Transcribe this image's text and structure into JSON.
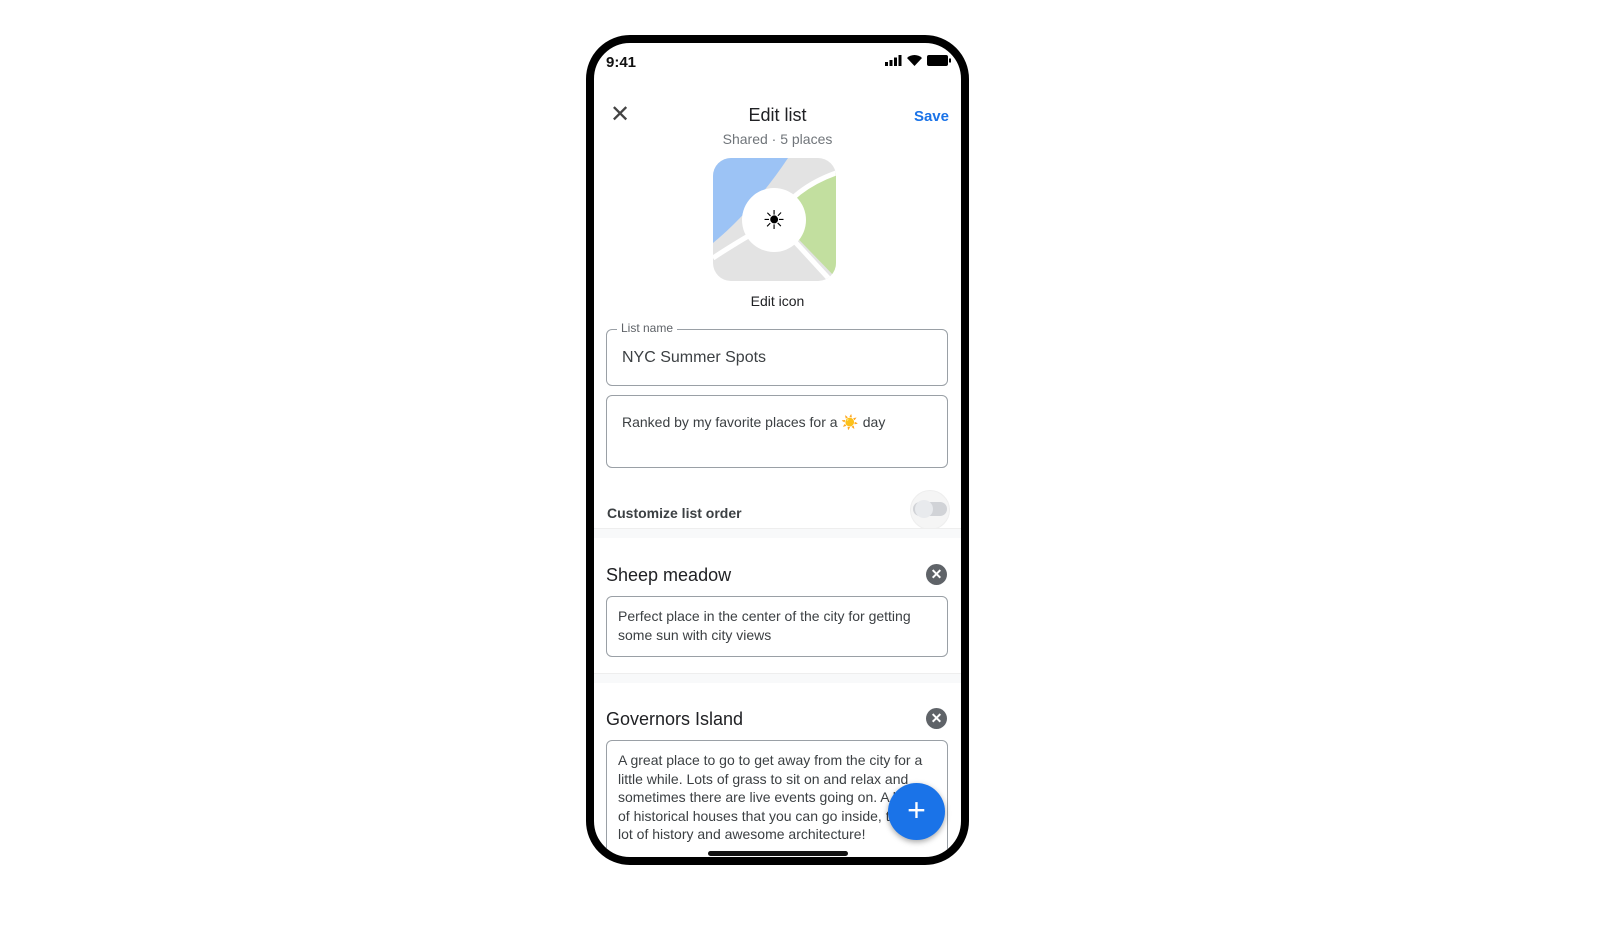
{
  "status": {
    "time": "9:41",
    "icons": [
      "signal-icon",
      "wifi-icon",
      "battery-icon"
    ]
  },
  "header": {
    "title": "Edit list",
    "subtitle": "Shared · 5 places",
    "save_label": "Save",
    "close_icon": "close-icon"
  },
  "list_icon": {
    "emoji": "☀️",
    "label": "Edit icon"
  },
  "form": {
    "name_label": "List name",
    "name_value": "NYC Summer Spots",
    "description_value": "Ranked by my favorite places for a ☀️ day"
  },
  "toggle": {
    "label": "Customize list order",
    "on": false
  },
  "places": [
    {
      "name": "Sheep meadow",
      "note": "Perfect place in the center of the city for getting some sun with city views"
    },
    {
      "name": "Governors Island",
      "note": "A great place to go to get away from the city for a little while. Lots of grass to sit on and relax and sometimes there are live events going on. A bunch of historical houses that you can go inside, too. A lot of history and awesome architecture!"
    }
  ],
  "fab": {
    "label": "+"
  },
  "colors": {
    "accent": "#1a73e8"
  }
}
